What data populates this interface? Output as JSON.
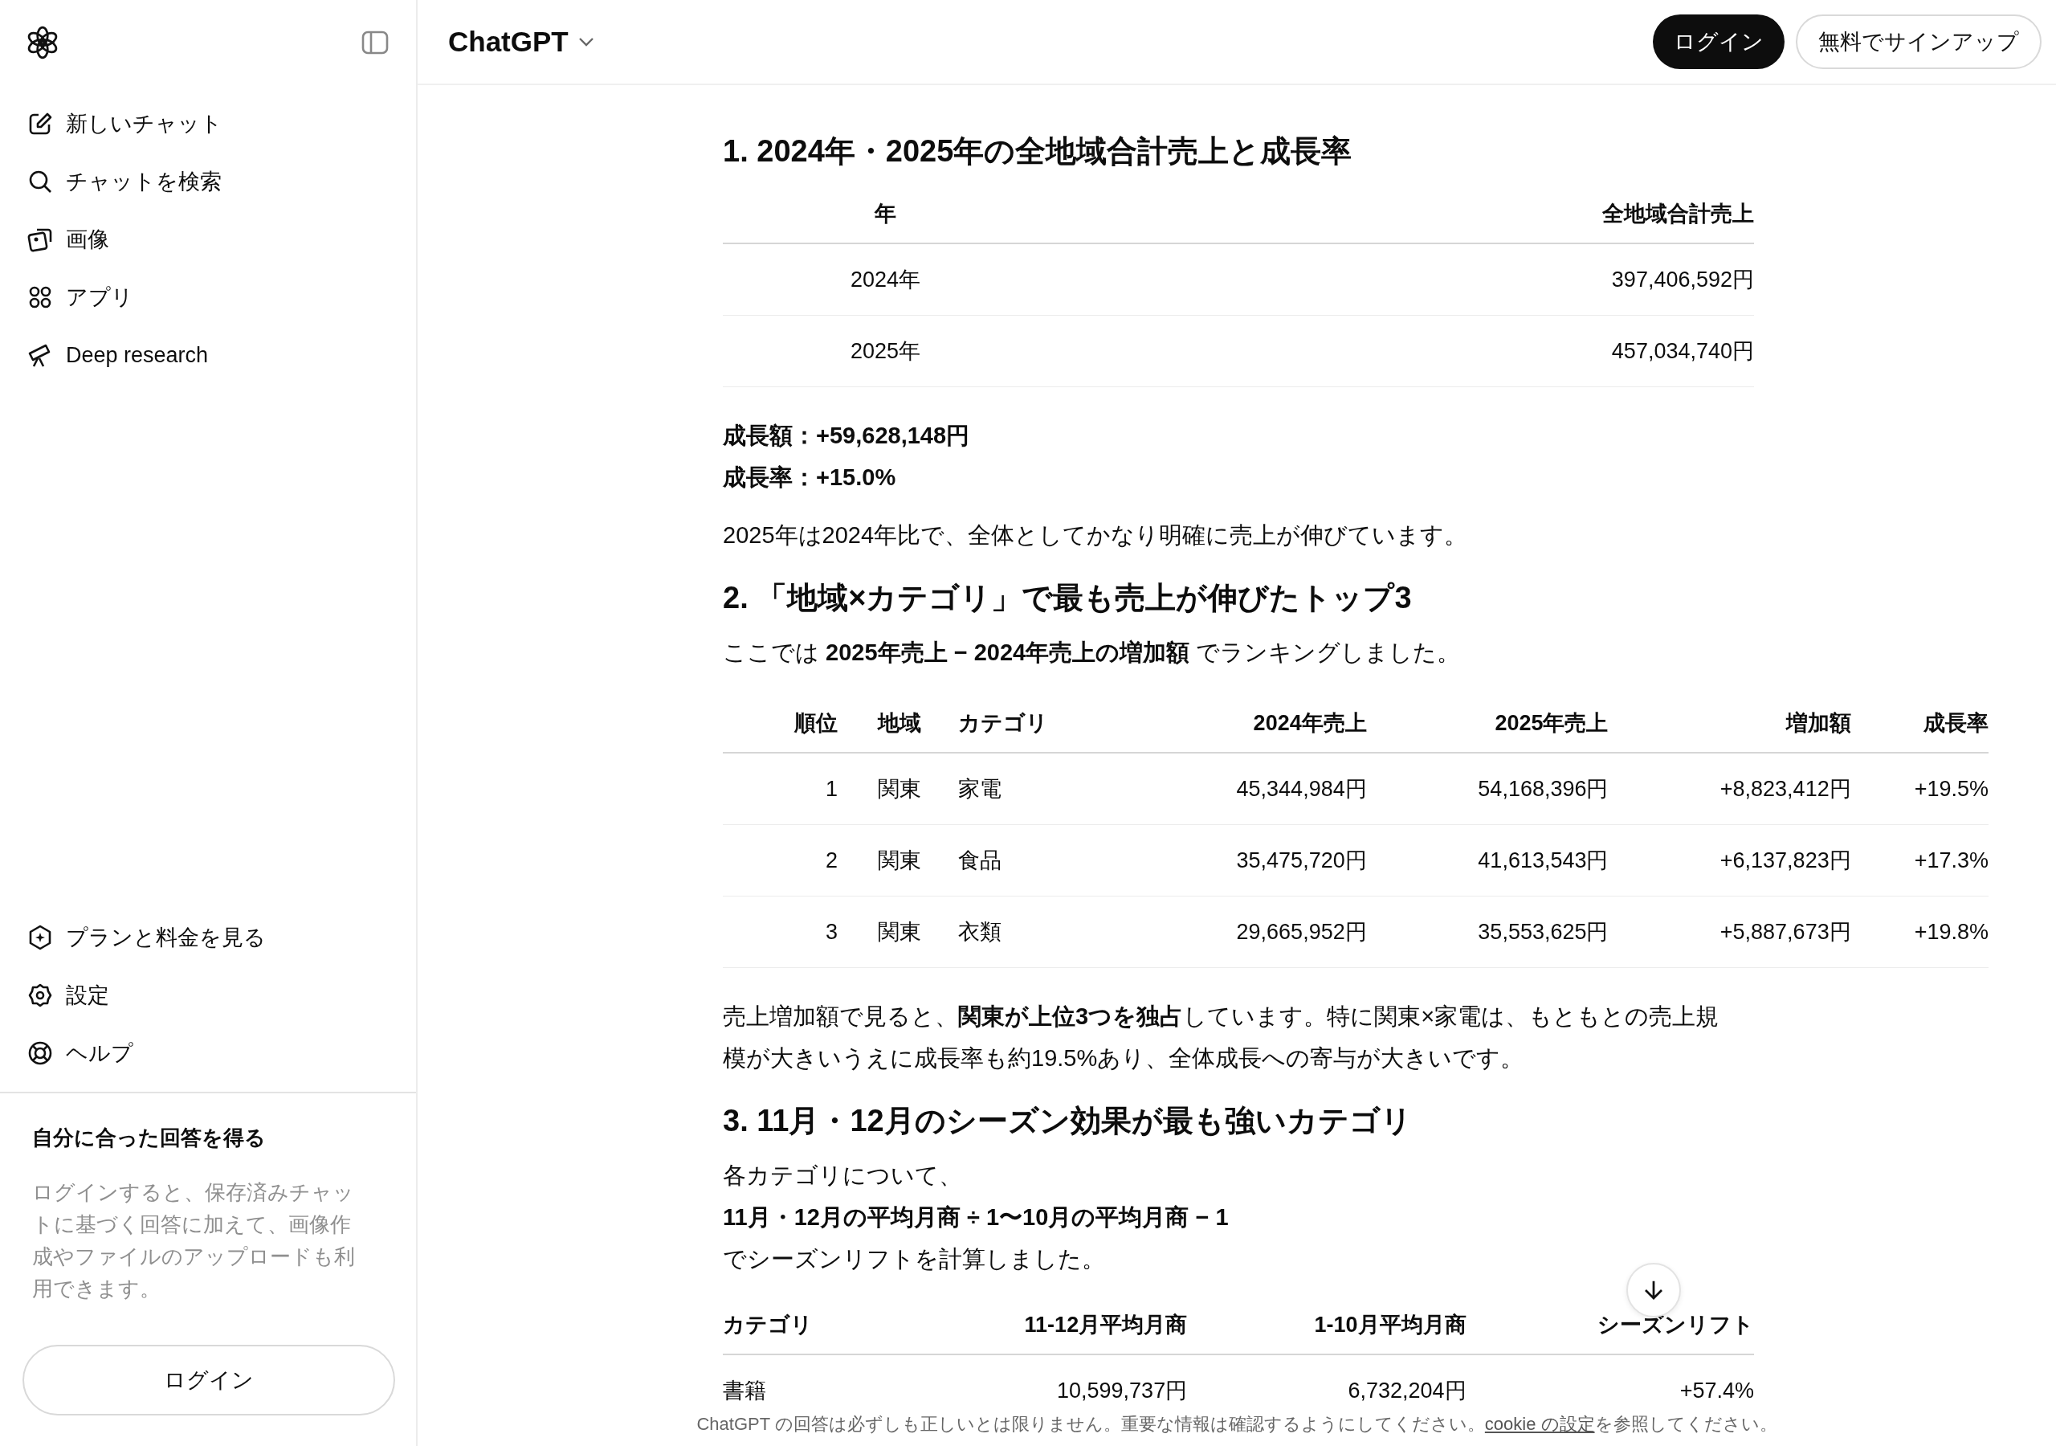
{
  "sidebar": {
    "nav_items": [
      {
        "label": "新しいチャット"
      },
      {
        "label": "チャットを検索"
      },
      {
        "label": "画像"
      },
      {
        "label": "アプリ"
      },
      {
        "label": "Deep research"
      }
    ],
    "bottom_items": [
      {
        "label": "プランと料金を見る"
      },
      {
        "label": "設定"
      },
      {
        "label": "ヘルプ"
      }
    ],
    "promo": {
      "title": "自分に合った回答を得る",
      "text": "ログインすると、保存済みチャットに基づく回答に加えて、画像作成やファイルのアップロードも利用できます。",
      "button": "ログイン"
    }
  },
  "header": {
    "title": "ChatGPT",
    "login": "ログイン",
    "signup": "無料でサインアップ"
  },
  "blocks": [
    {
      "kind": "heading",
      "text": "1. 2024年・2025年の全地域合計売上と成長率"
    },
    {
      "kind": "table",
      "columns": [
        "年",
        "全地域合計売上"
      ],
      "rows": [
        [
          "2024年",
          "397,406,592円"
        ],
        [
          "2025年",
          "457,034,740円"
        ]
      ]
    },
    {
      "kind": "lines",
      "lines": [
        {
          "text": "成長額：+59,628,148円",
          "bold": true
        },
        {
          "text": "成長率：+15.0%",
          "bold": true
        }
      ]
    },
    {
      "kind": "para",
      "text": "2025年は2024年比で、全体としてかなり明確に売上が伸びています。"
    },
    {
      "kind": "heading",
      "text": "2. 「地域×カテゴリ」で最も売上が伸びたトップ3"
    },
    {
      "kind": "para",
      "text": "ここでは **2025年売上 − 2024年売上の増加額** でランキングしました。"
    },
    {
      "kind": "table",
      "columns": [
        "順位",
        "地域",
        "カテゴリ",
        "2024年売上",
        "2025年売上",
        "増加額",
        "成長率"
      ],
      "rows": [
        [
          "1",
          "関東",
          "家電",
          "45,344,984円",
          "54,168,396円",
          "+8,823,412円",
          "+19.5%"
        ],
        [
          "2",
          "関東",
          "食品",
          "35,475,720円",
          "41,613,543円",
          "+6,137,823円",
          "+17.3%"
        ],
        [
          "3",
          "関東",
          "衣類",
          "29,665,952円",
          "35,553,625円",
          "+5,887,673円",
          "+19.8%"
        ]
      ]
    },
    {
      "kind": "para",
      "text": "売上増加額で見ると、**関東が上位3つを独占**しています。特に関東×家電は、もともとの売上規模が大きいうえに成長率も約19.5%あり、全体成長への寄与が大きいです。"
    },
    {
      "kind": "heading",
      "text": "3. 11月・12月のシーズン効果が最も強いカテゴリ"
    },
    {
      "kind": "lines",
      "lines": [
        {
          "text": "各カテゴリについて、",
          "bold": false
        },
        {
          "text": "11月・12月の平均月商 ÷ 1〜10月の平均月商 − 1",
          "bold": true
        },
        {
          "text": "でシーズンリフトを計算しました。",
          "bold": false
        }
      ]
    },
    {
      "kind": "table",
      "columns": [
        "カテゴリ",
        "11-12月平均月商",
        "1-10月平均月商",
        "シーズンリフト"
      ],
      "rows": [
        [
          "書籍",
          "10,599,737円",
          "6,732,204円",
          "+57.4%"
        ]
      ]
    }
  ],
  "disclaimer": {
    "text": "ChatGPT の回答は必ずしも正しいとは限りません。重要な情報は確認するようにしてください。",
    "link": "cookie の設定",
    "after": "を参照してください。"
  }
}
